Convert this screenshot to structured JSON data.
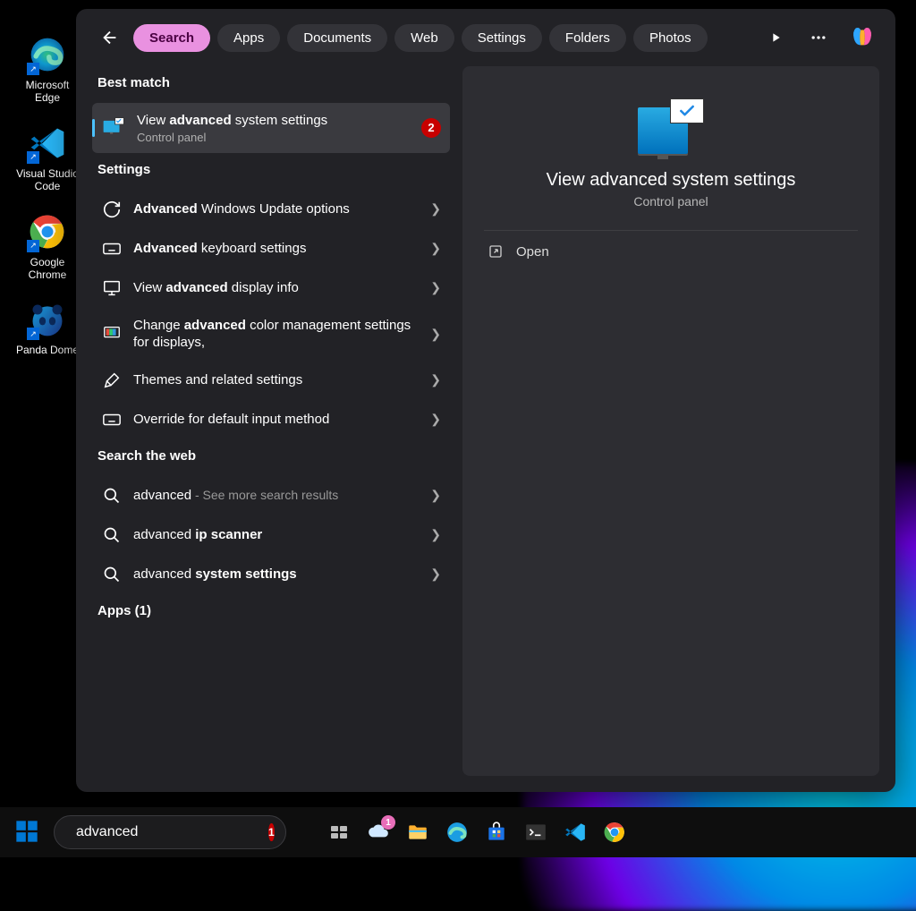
{
  "desktop": [
    {
      "name": "Microsoft Edge",
      "icon": "edge"
    },
    {
      "name": "Visual Studio Code",
      "icon": "vscode"
    },
    {
      "name": "Google Chrome",
      "icon": "chrome"
    },
    {
      "name": "Panda Dome",
      "icon": "panda"
    }
  ],
  "tabs": [
    "Search",
    "Apps",
    "Documents",
    "Web",
    "Settings",
    "Folders",
    "Photos"
  ],
  "active_tab": "Search",
  "sections": {
    "best": "Best match",
    "settings": "Settings",
    "web": "Search the web",
    "apps": "Apps (1)"
  },
  "best_match": {
    "title_pre": "View ",
    "title_bold": "advanced",
    "title_post": " system settings",
    "subtitle": "Control panel",
    "badge": "2"
  },
  "settings_results": [
    {
      "icon": "sync",
      "pre": "",
      "bold": "Advanced",
      "post": " Windows Update options"
    },
    {
      "icon": "keyboard",
      "pre": "",
      "bold": "Advanced",
      "post": " keyboard settings"
    },
    {
      "icon": "display",
      "pre": "View ",
      "bold": "advanced",
      "post": " display info"
    },
    {
      "icon": "color",
      "pre": "Change ",
      "bold": "advanced",
      "post": " color management settings for displays,"
    },
    {
      "icon": "brush",
      "pre": "Themes and related settings",
      "bold": "",
      "post": ""
    },
    {
      "icon": "keyboard",
      "pre": "Override for default input method",
      "bold": "",
      "post": ""
    }
  ],
  "web_results": [
    {
      "term": "advanced",
      "extra": " - See more search results"
    },
    {
      "term_pre": "advanced ",
      "term_bold": "ip scanner"
    },
    {
      "term_pre": "advanced ",
      "term_bold": "system settings"
    }
  ],
  "preview": {
    "title": "View advanced system settings",
    "subtitle": "Control panel",
    "action": "Open"
  },
  "taskbar": {
    "search_value": "advanced",
    "search_badge": "1",
    "weather_badge": "1"
  }
}
